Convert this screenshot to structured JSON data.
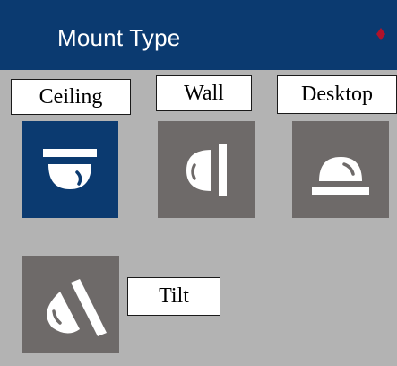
{
  "header": {
    "title": "Mount Type",
    "required_marker": "*"
  },
  "mount_options": [
    {
      "label": "Ceiling",
      "icon": "ceiling-mount-icon",
      "selected": true
    },
    {
      "label": "Wall",
      "icon": "wall-mount-icon",
      "selected": false
    },
    {
      "label": "Desktop",
      "icon": "desktop-mount-icon",
      "selected": false
    },
    {
      "label": "Tilt",
      "icon": "tilt-mount-icon",
      "selected": false
    }
  ],
  "colors": {
    "header_bg": "#0b3a70",
    "selected_tile": "#0b3a70",
    "unselected_tile": "#6e6a69",
    "panel_bg": "#b3b3b3",
    "icon": "#ffffff",
    "required_marker": "#b0122a"
  }
}
